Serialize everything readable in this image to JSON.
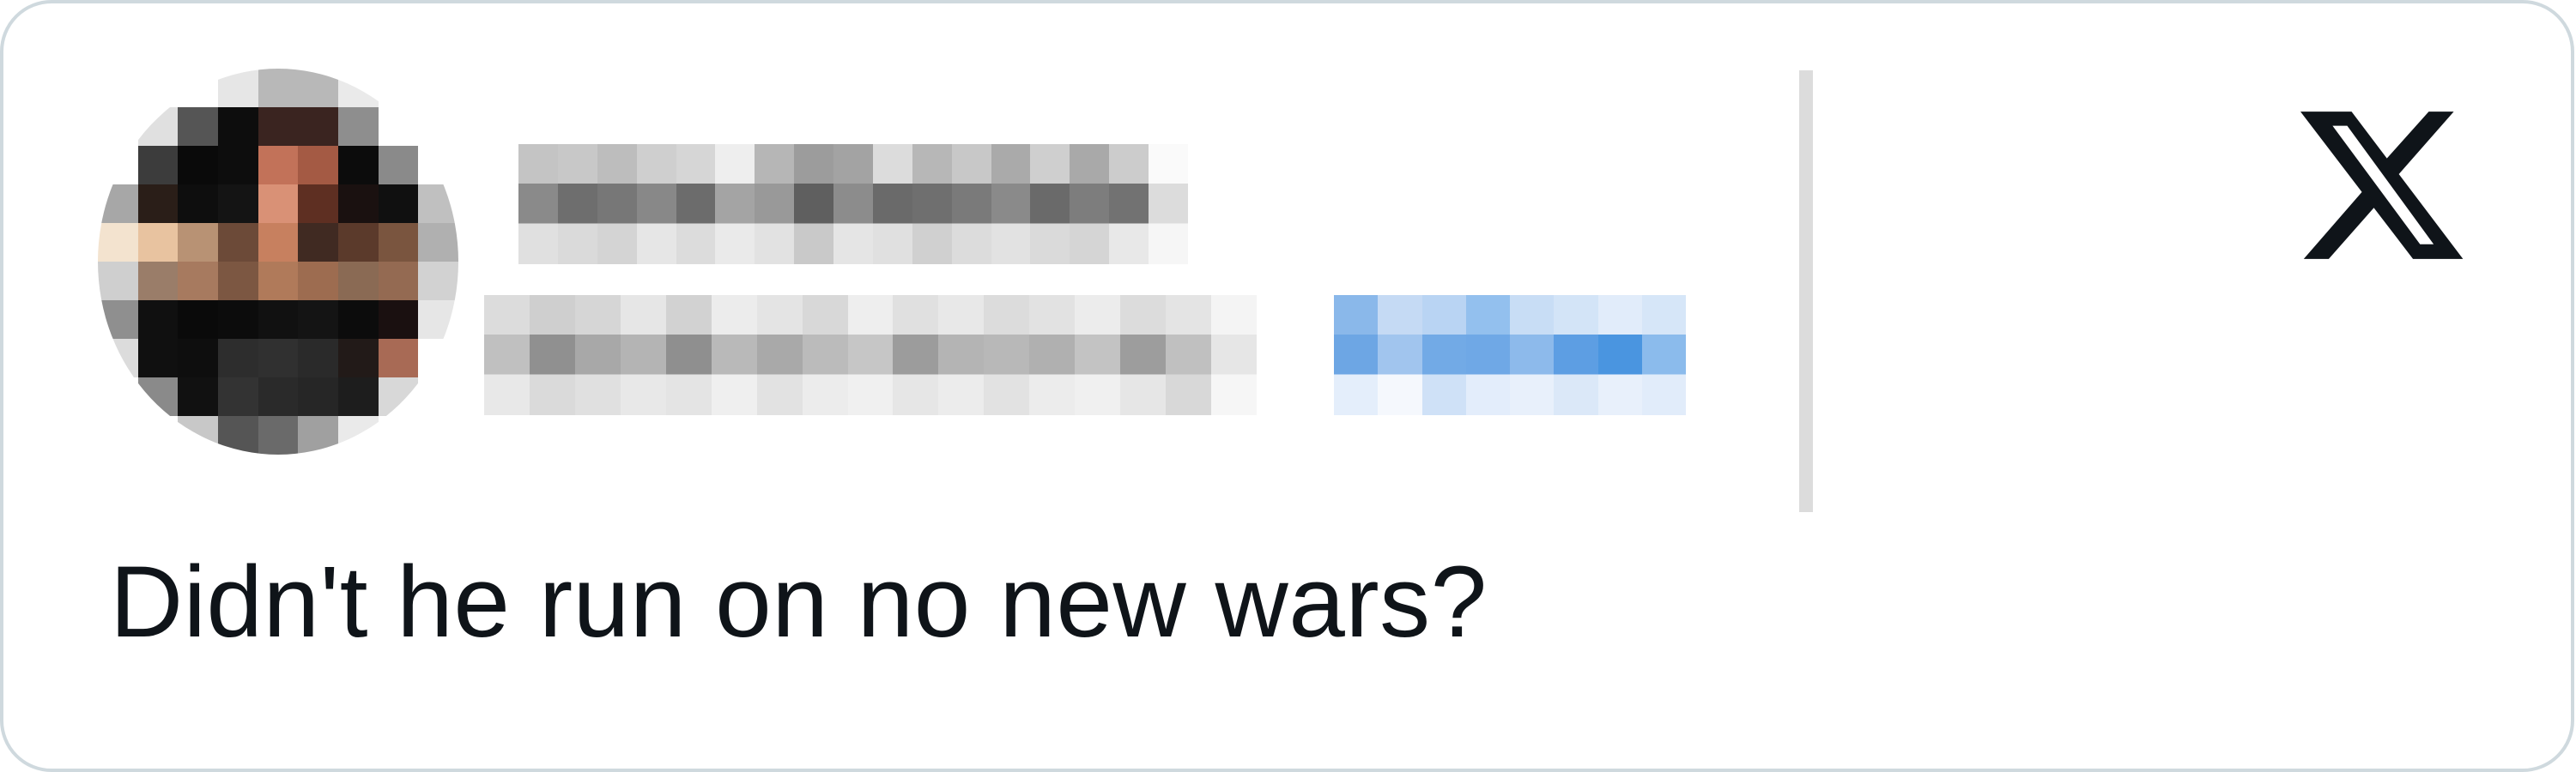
{
  "tweet": {
    "text": "Didn't he run on no new wars?"
  },
  "author": {
    "name": "",
    "handle": "",
    "follow_label": ""
  },
  "icons": {
    "brand": "x-logo-icon",
    "avatar": "avatar"
  },
  "colors": {
    "text": "#0f1419",
    "border": "#cfd9de",
    "follow_blue": "#4a95e0",
    "divider": "#dcdcdc"
  }
}
